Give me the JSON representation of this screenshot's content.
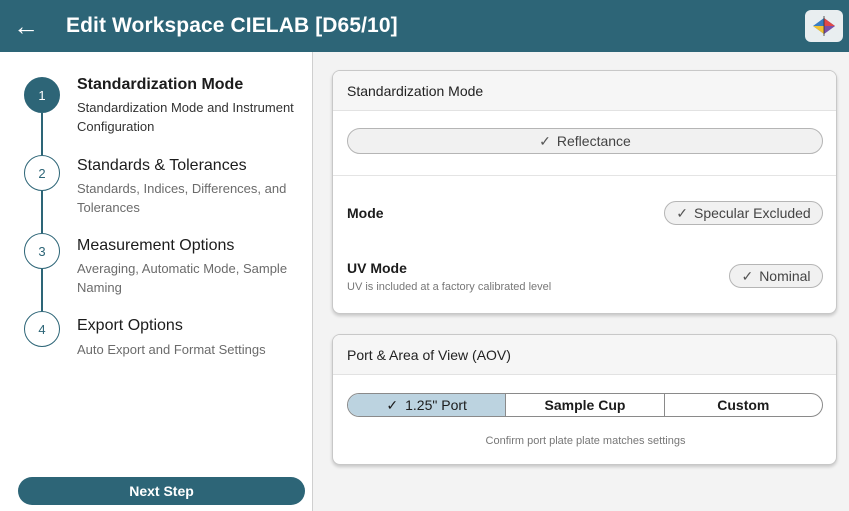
{
  "header": {
    "back_icon": "arrow-left-icon",
    "title": "Edit Workspace CIELAB [D65/10]",
    "app_icon": "color-space-icon",
    "accent": "#2d6577"
  },
  "sidebar": {
    "steps": [
      {
        "number": "1",
        "title": "Standardization Mode",
        "subtitle": "Standardization Mode and Instrument Configuration",
        "active": true
      },
      {
        "number": "2",
        "title": "Standards & Tolerances",
        "subtitle": "Standards, Indices, Differences, and Tolerances",
        "active": false
      },
      {
        "number": "3",
        "title": "Measurement Options",
        "subtitle": "Averaging, Automatic Mode, Sample Naming",
        "active": false
      },
      {
        "number": "4",
        "title": "Export Options",
        "subtitle": "Auto Export and Format Settings",
        "active": false
      }
    ],
    "next_label": "Next Step"
  },
  "standardization": {
    "header": "Standardization Mode",
    "check_icon": "checkmark-icon",
    "reflectance_label": "Reflectance",
    "mode_label": "Mode",
    "mode_value": "Specular Excluded",
    "uv_label": "UV Mode",
    "uv_hint": "UV is included at a factory calibrated level",
    "uv_value": "Nominal"
  },
  "port": {
    "header": "Port & Area of View (AOV)",
    "options": [
      "1.25\" Port",
      "Sample Cup",
      "Custom"
    ],
    "selected": "1.25\" Port",
    "note": "Confirm port plate plate matches settings"
  }
}
